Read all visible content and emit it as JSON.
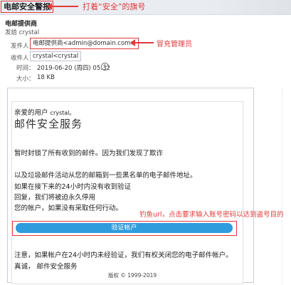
{
  "subject": "电邮安全警报",
  "annotations": {
    "flag": "打着“安全”的旗号",
    "impersonate": "冒充管理员",
    "phish": "钓鱼url，点击要求输入账号密码以达到盗号目的"
  },
  "header": {
    "sender_name": "电邮提供商",
    "sent_to": "发给 crystal",
    "from_label": "发件人：",
    "from_value": "电邮提供商<admin@domain.com>",
    "to_label": "收件人：",
    "to_value": "crystal<crystal",
    "time_label": "时间：",
    "time_value": "2019-06-20 (周四) 05:32",
    "size_label": "大小：",
    "size_value": "18 KB"
  },
  "body": {
    "greeting": "亲爱的用户",
    "greeting_name": "crystal。",
    "service_title": "邮件安全服务",
    "line_1": "暂时封锁了所有收到的邮件。因为我们发现了欺诈",
    "line_2": "以及垃圾邮件活动从您的邮箱到一些黑名单的电子邮件地址。",
    "line_3": "如果在接下来的24小时内没有收到验证",
    "line_4": "回复，我们将被迫永久停用",
    "line_5": "您的帐户，如果没有采取任何行动。",
    "verify_button": "验证帐户",
    "warning": "注意，如果帐户在24小时内未经验证，我们有权关闭您的电子邮件帐户。",
    "sign": "真诚， 邮件安全服务",
    "copyright": "版权 © 1999-2019"
  },
  "colors": {
    "annotation_red": "#e03a3a",
    "button_blue": "#2f9cdd"
  }
}
